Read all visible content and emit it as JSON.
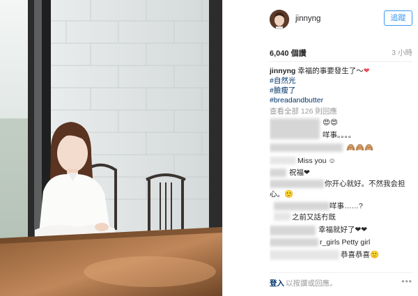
{
  "post": {
    "username": "jinnyng",
    "follow_label": "追蹤",
    "likes": "6,040 個讚",
    "time_ago": "3 小時"
  },
  "caption": {
    "username": "jinnyng",
    "text": " 幸福的事要發生了～",
    "hashtags": [
      "#自然光",
      "#臉瘦了",
      "#breadandbutter"
    ]
  },
  "view_all": "查看全部 126 則回應",
  "comments": [
    {
      "text": "😍😍"
    },
    {
      "text": "咩事。。。。"
    },
    {
      "text": "🙈🙈🙈"
    },
    {
      "text": "Miss you ☺"
    },
    {
      "text": "祝福❤"
    },
    {
      "text": "你开心就好。不然我会担"
    },
    {
      "text": "心。🙂"
    },
    {
      "text": "咩事……?"
    },
    {
      "text": "之前又話冇既"
    },
    {
      "text": "幸福就好了❤❤"
    },
    {
      "text": "r_girls Petty girl"
    },
    {
      "text": "恭喜恭喜🙂"
    }
  ],
  "footer": {
    "login_label": "登入",
    "login_suffix": "以按讚或回應。",
    "more_label": "•••"
  },
  "colors": {
    "accent": "#3897f0",
    "hashtag": "#003569",
    "heart": "#ed4956",
    "muted": "#999999"
  }
}
